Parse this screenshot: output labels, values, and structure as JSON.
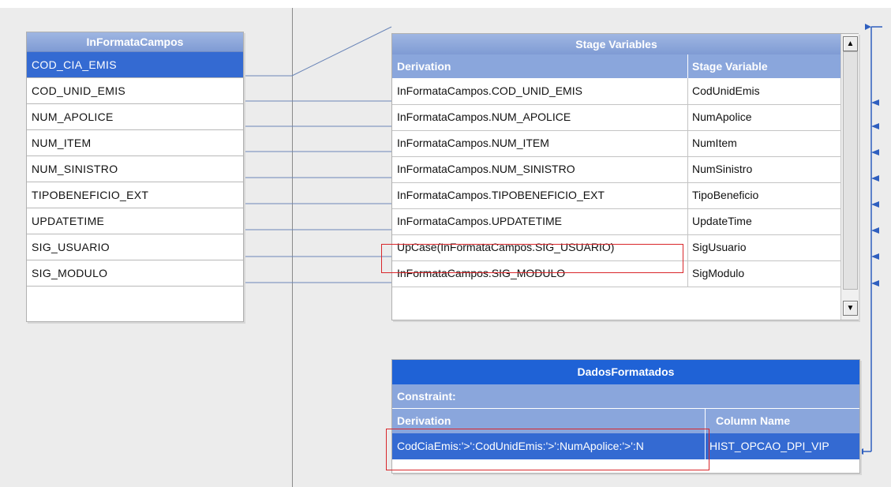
{
  "input_link": {
    "title": "InFormataCampos",
    "columns": [
      "COD_CIA_EMIS",
      "COD_UNID_EMIS",
      "NUM_APOLICE",
      "NUM_ITEM",
      "NUM_SINISTRO",
      "TIPOBENEFICIO_EXT",
      "UPDATETIME",
      "SIG_USUARIO",
      "SIG_MODULO"
    ],
    "selected_column": "COD_CIA_EMIS"
  },
  "stage_variables": {
    "title": "Stage Variables",
    "headers": {
      "derivation": "Derivation",
      "variable": "Stage Variable"
    },
    "rows": [
      {
        "derivation": "InFormataCampos.COD_UNID_EMIS",
        "variable": "CodUnidEmis"
      },
      {
        "derivation": "InFormataCampos.NUM_APOLICE",
        "variable": "NumApolice"
      },
      {
        "derivation": "InFormataCampos.NUM_ITEM",
        "variable": "NumItem"
      },
      {
        "derivation": "InFormataCampos.NUM_SINISTRO",
        "variable": "NumSinistro"
      },
      {
        "derivation": "InFormataCampos.TIPOBENEFICIO_EXT",
        "variable": "TipoBeneficio"
      },
      {
        "derivation": "InFormataCampos.UPDATETIME",
        "variable": "UpdateTime"
      },
      {
        "derivation": "UpCase(InFormataCampos.SIG_USUARIO)",
        "variable": "SigUsuario"
      },
      {
        "derivation": "InFormataCampos.SIG_MODULO",
        "variable": "SigModulo"
      }
    ],
    "highlighted_row": 6
  },
  "output_link": {
    "title": "DadosFormatados",
    "constraint_label": "Constraint:",
    "headers": {
      "derivation": "Derivation",
      "column": "Column Name"
    },
    "rows": [
      {
        "derivation": "CodCiaEmis:'>':CodUnidEmis:'>':NumApolice:'>':N",
        "column": "HIST_OPCAO_DPI_VIP"
      }
    ]
  },
  "icons": {
    "scroll_up": "scroll-up-arrow-icon",
    "scroll_down": "scroll-down-arrow-icon",
    "link_arrow": "link-arrow-icon"
  },
  "colors": {
    "header_blue": "#8aa6dc",
    "selected_blue": "#346ad2",
    "title_blue": "#1f62d6",
    "link_line": "#2f5fbf",
    "highlight_red": "#d9262a"
  }
}
